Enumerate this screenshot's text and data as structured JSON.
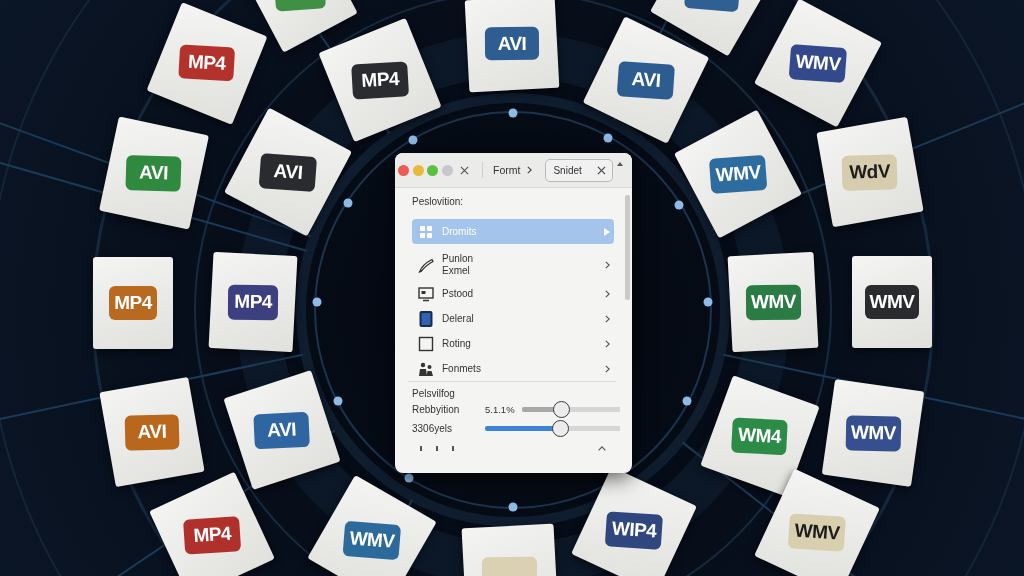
{
  "tiles": [
    {
      "color": "#3f8f45"
    },
    {
      "color": "#2f5f93"
    },
    {
      "label": "MP4",
      "color": "#b3332c"
    },
    {
      "label": "AVI",
      "color": "#2e5d92"
    },
    {
      "label": "WMV",
      "color": "#34498c"
    },
    {
      "label": "MP4",
      "color": "#2b2c30"
    },
    {
      "label": "AVI",
      "color": "#2d5c91"
    },
    {
      "label": "AVI",
      "color": "#2f8a3f"
    },
    {
      "label": "AVI",
      "color": "#2a2b2f"
    },
    {
      "label": "WMV",
      "color": "#2c6c9f"
    },
    {
      "label": "WdV",
      "color": "#d5cdae"
    },
    {
      "label": "MP4",
      "color": "#b86a20"
    },
    {
      "label": "MP4",
      "color": "#3c3f80"
    },
    {
      "label": "WMV",
      "color": "#2b7b45"
    },
    {
      "label": "WMV",
      "color": "#2a2b2f"
    },
    {
      "label": "AVI",
      "color": "#b9671d"
    },
    {
      "label": "AVI",
      "color": "#2f65a1"
    },
    {
      "label": "WM4",
      "color": "#2c8b47"
    },
    {
      "label": "WMV",
      "color": "#354f8f"
    },
    {
      "label": "WMV",
      "color": "#2c6a9c"
    },
    {
      "label": "WIP4",
      "color": "#30467f"
    },
    {
      "label": "MP4",
      "color": "#b0312b"
    },
    {
      "label": "WMV",
      "color": "#d7cfae"
    },
    {
      "color": "#d9d1b1"
    }
  ],
  "dialog": {
    "breadcrumb": "Formt",
    "chip": "Snidet",
    "section_label": "Peslovition:",
    "items": [
      {
        "label": "Dromits",
        "selected": true
      },
      {
        "label": "Punlon Exmel",
        "selected": false
      },
      {
        "label": "Pstood",
        "selected": false
      },
      {
        "label": "Deleral",
        "selected": false
      },
      {
        "label": "Roting",
        "selected": false
      },
      {
        "label": "Fonmets",
        "selected": false
      }
    ],
    "settings_title": "Pelsvilfog",
    "sliders": [
      {
        "label": "Rebbyition",
        "reading": "5.1.1%",
        "level": 0.4,
        "kind": "neutral"
      },
      {
        "label": "3306yels",
        "level": 0.56,
        "kind": "accent"
      }
    ]
  }
}
